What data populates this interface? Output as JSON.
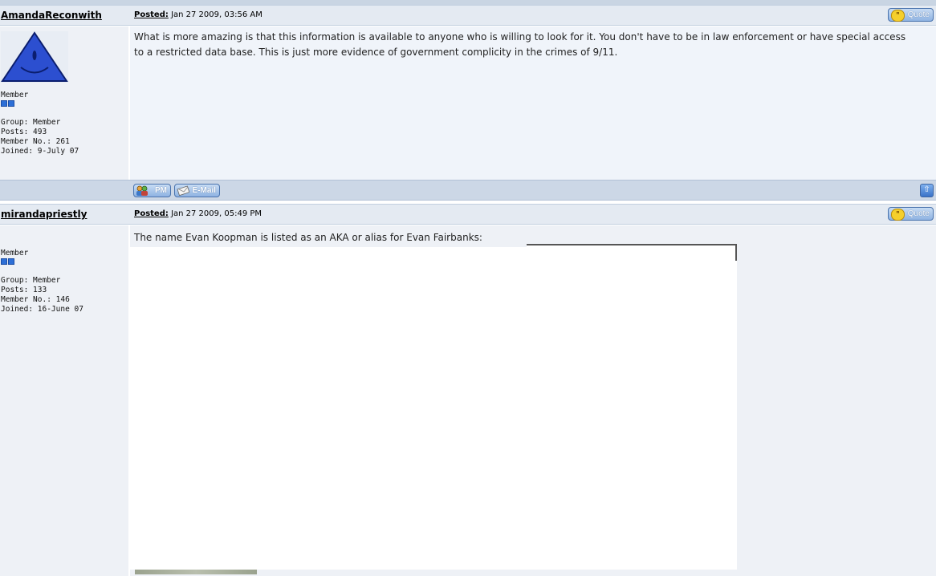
{
  "posts": [
    {
      "author": "AmandaReconwith",
      "posted_label": "Posted:",
      "date": "Jan 27 2009, 03:56 AM",
      "quote_label": "Quote",
      "rank": "Member",
      "group": "Group: Member",
      "posts": "Posts: 493",
      "member_no": "Member No.: 261",
      "joined": "Joined: 9-July 07",
      "body": "What is more amazing is that this information is available to anyone who is willing to look for it. You don't have to be in law enforcement or have special access to a restricted data base. This is just more evidence of government complicity in the crimes of 9/11."
    },
    {
      "author": "mirandapriestly",
      "posted_label": "Posted:",
      "date": "Jan 27 2009, 05:49 PM",
      "quote_label": "Quote",
      "rank": "Member",
      "group": "Group: Member",
      "posts": "Posts: 133",
      "member_no": "Member No.: 146",
      "joined": "Joined: 16-June 07",
      "body": "The name Evan Koopman is listed as an AKA or alias for Evan Fairbanks:"
    }
  ],
  "footer": {
    "pm_label": "PM",
    "email_label": "E-Mail"
  },
  "colors": {
    "header_bg": "#e4eaf2",
    "body_bg": "#f0f4fa",
    "side_bg": "#eef1f6",
    "button_blue": "#8fb3e2"
  },
  "icons": [
    "quote-icon",
    "pm-icon",
    "email-icon",
    "back-to-top-icon",
    "triangle-smiley-avatar"
  ]
}
